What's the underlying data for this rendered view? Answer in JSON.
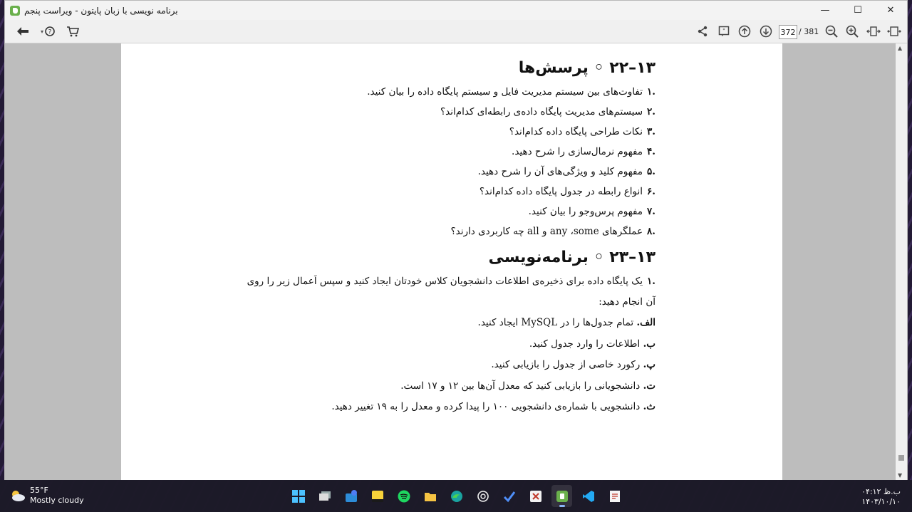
{
  "window": {
    "title": "برنامه نویسی با زبان پایتون - ویراست پنجم",
    "controls": {
      "minimize": "—",
      "maximize": "☐",
      "close": "✕"
    }
  },
  "toolbar": {
    "current_page": "372",
    "total_pages": "/ 381",
    "icons": [
      "back-arrow-icon",
      "help-icon",
      "cart-icon",
      "share-icon",
      "comment-icon",
      "page-up-icon",
      "page-down-icon",
      "zoom-out-icon",
      "zoom-in-icon",
      "fit-width-icon",
      "fit-page-icon"
    ]
  },
  "content": {
    "section1": {
      "heading": "۱۳–۲۲ ◦ پرسش‌ها",
      "questions": [
        {
          "num": ".۱",
          "text": "تفاوت‌های بین سیستم مدیریت فایل و سیستم پایگاه داده را بیان کنید."
        },
        {
          "num": ".۲",
          "text": "سیستم‌های مدیریت پایگاه داده‌ی رابطه‌ای کدام‌اند؟"
        },
        {
          "num": ".۳",
          "text": "نکات طراحی پایگاه داده کدام‌اند؟"
        },
        {
          "num": ".۴",
          "text": "مفهوم نرمال‌سازی را شرح دهید."
        },
        {
          "num": ".۵",
          "text": "مفهوم کلید و ویژگی‌های آن را شرح دهید."
        },
        {
          "num": ".۶",
          "text": "انواع رابطه در جدول پایگاه داده کدام‌اند؟"
        },
        {
          "num": ".۷",
          "text": "مفهوم پرس‌وجو را بیان کنید."
        },
        {
          "num": ".۸",
          "text": "عملگرهای any ،some و all چه کاربردی دارند؟"
        }
      ]
    },
    "section2": {
      "heading": "۱۳–۲۳ ◦ برنامه‌نویسی",
      "item": {
        "num": ".۱",
        "text": "یک پایگاه داده برای ذخیره‌ی اطلاعات دانشجویان کلاس خودتان ایجاد کنید و سپس اَعمال زیر را روی آن انجام دهید:"
      },
      "subitems": [
        {
          "label": "الف.",
          "text": "تمام جدول‌ها را در MySQL ایجاد کنید."
        },
        {
          "label": "ب.",
          "text": "اطلاعات را وارد جدول کنید."
        },
        {
          "label": "پ.",
          "text": "رکورد خاصی از جدول را بازیابی کنید."
        },
        {
          "label": "ت.",
          "text": "دانشجویانی را بازیابی کنید که معدل آن‌ها بین ۱۲ و ۱۷ است."
        },
        {
          "label": "ث.",
          "text": "دانشجویی با شماره‌ی دانشجویی ۱۰۰ را پیدا کرده و معدل را به ۱۹ تغییر دهید."
        }
      ]
    }
  },
  "taskbar": {
    "weather_temp": "55°F",
    "weather_desc": "Mostly cloudy",
    "clock_time": "۰۴:۱۲ ب.ظ",
    "clock_date": "۱۴۰۳/۱۰/۱۰",
    "apps": [
      "windows-start-icon",
      "task-view-icon",
      "store-icon",
      "sticky-notes-icon",
      "spotify-icon",
      "file-explorer-icon",
      "edge-icon",
      "chatgpt-icon",
      "todo-icon",
      "code-editor-icon",
      "reader-app-icon",
      "vscode-icon",
      "notepad-icon"
    ]
  }
}
